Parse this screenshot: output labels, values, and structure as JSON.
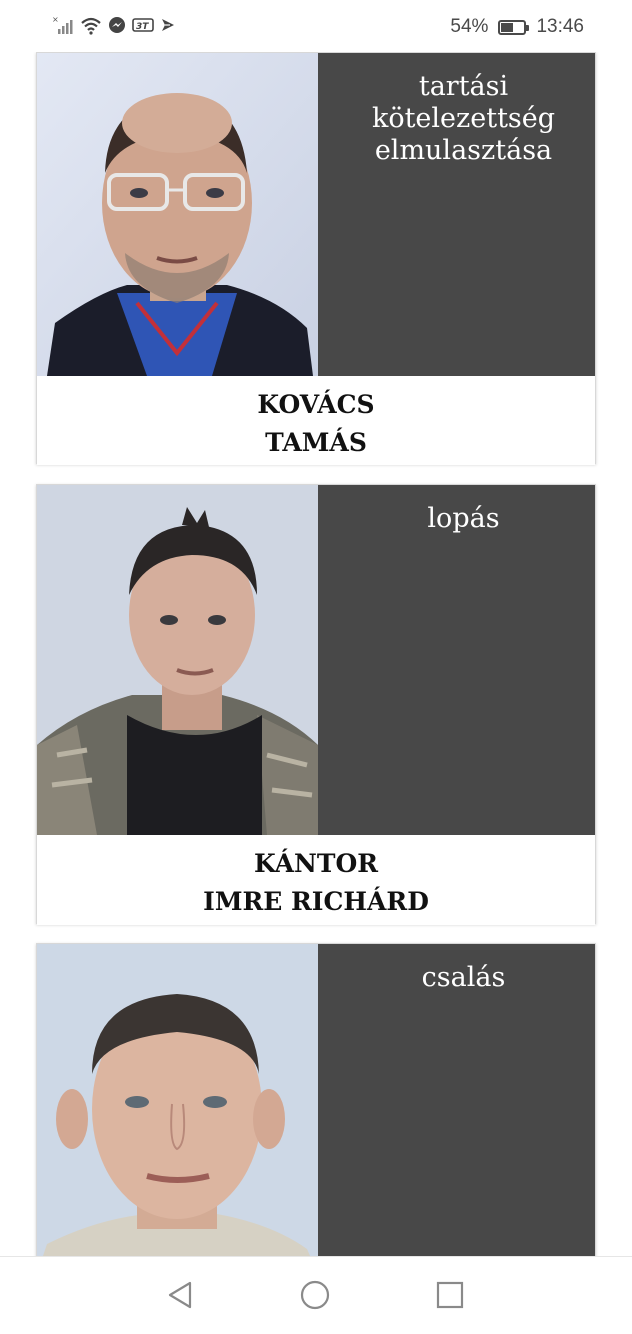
{
  "status_bar": {
    "battery": "54%",
    "battery_level": 0.54,
    "time": "13:46",
    "network_badge": "3T",
    "left_icons": [
      "signal-icon",
      "wifi-icon",
      "messenger-icon",
      "network-badge-icon",
      "send-icon"
    ]
  },
  "cards": [
    {
      "crime": "tartási kötelezettség elmulasztása",
      "name_line1": "KOVÁCS",
      "name_line2": "TAMÁS"
    },
    {
      "crime": "lopás",
      "name_line1": "KÁNTOR",
      "name_line2": "IMRE RICHÁRD"
    },
    {
      "crime": "csalás"
    }
  ],
  "nav_bar": {
    "back_icon": "back-triangle-icon",
    "home_icon": "home-circle-icon",
    "recents_icon": "recents-square-icon"
  },
  "colors": {
    "crime_panel_bg": "#484848",
    "card_border": "#d8d8d8"
  }
}
